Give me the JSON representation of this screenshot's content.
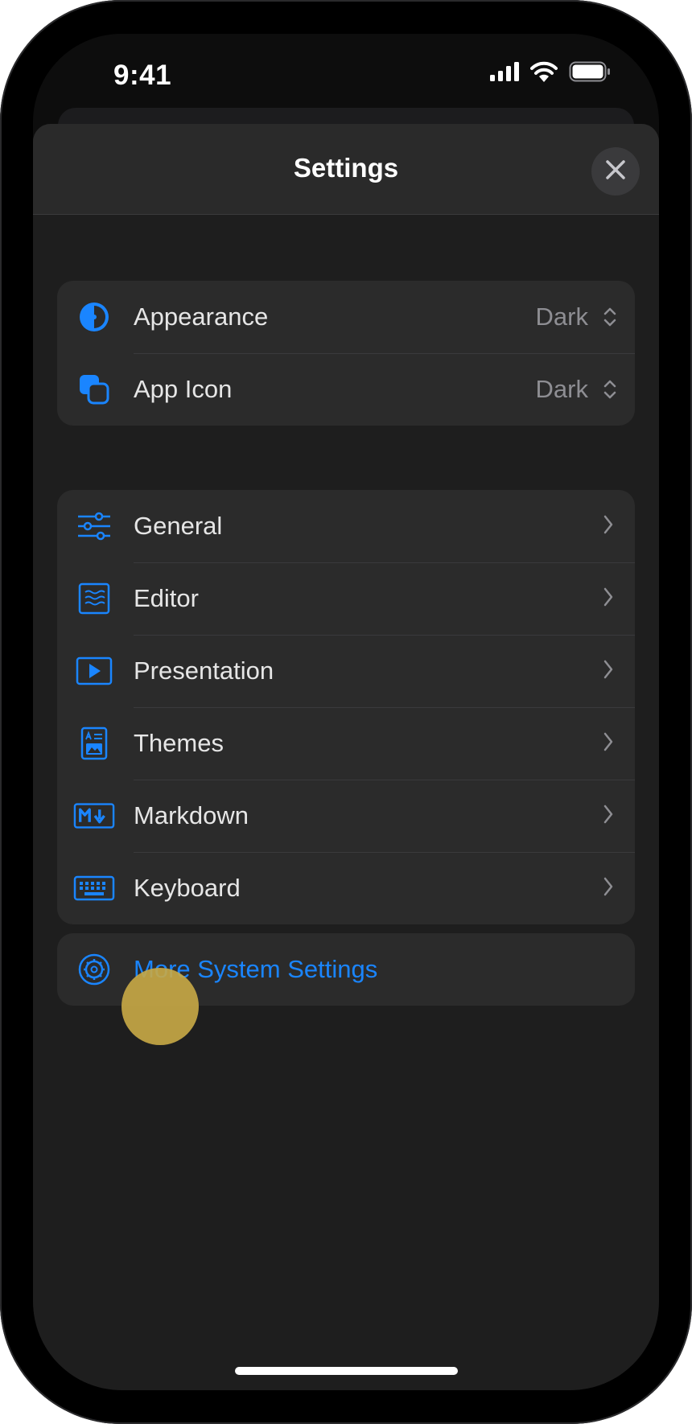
{
  "status_bar": {
    "time": "9:41"
  },
  "sheet": {
    "title": "Settings"
  },
  "groups": {
    "appearance": [
      {
        "label": "Appearance",
        "value": "Dark",
        "icon": "appearance-icon"
      },
      {
        "label": "App Icon",
        "value": "Dark",
        "icon": "app-icon-icon"
      }
    ],
    "settings": [
      {
        "label": "General",
        "icon": "sliders-icon"
      },
      {
        "label": "Editor",
        "icon": "editor-icon"
      },
      {
        "label": "Presentation",
        "icon": "play-icon"
      },
      {
        "label": "Themes",
        "icon": "themes-icon"
      },
      {
        "label": "Markdown",
        "icon": "markdown-icon"
      },
      {
        "label": "Keyboard",
        "icon": "keyboard-icon"
      }
    ],
    "system": {
      "label": "More System Settings",
      "icon": "gear-icon"
    }
  },
  "colors": {
    "accent": "#1a85ff",
    "background": "#1e1e1e",
    "group_background": "#2b2b2b",
    "tap_indicator": "#c9aa46"
  }
}
